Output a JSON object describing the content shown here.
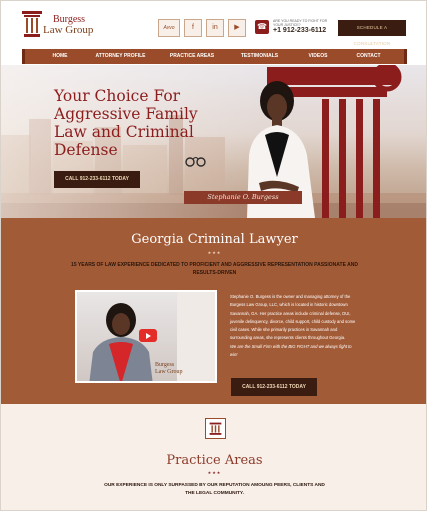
{
  "header": {
    "logo_line1": "Burgess",
    "logo_line2": "Law Group",
    "social": {
      "avvo": "Avvo",
      "facebook": "f",
      "linkedin": "in",
      "youtube": "▶"
    },
    "phone_caption": "ARE YOU READY TO FIGHT FOR YOUR JUSTICE?",
    "phone_number": "+1 912-233-6112",
    "consult_button": "SCHEDULE A CONSULTATION"
  },
  "nav": {
    "items": [
      "HOME",
      "ATTORNEY PROFILE",
      "PRACTICE AREAS",
      "TESTIMONIALS",
      "VIDEOS",
      "CONTACT"
    ]
  },
  "hero": {
    "headline": "Your Choice For Aggressive Family Law and Criminal Defense",
    "cta": "CALL 912-233-6112 TODAY",
    "signature": "Stephanie O. Burgess"
  },
  "georgia": {
    "title": "Georgia Criminal Lawyer",
    "stars": "★★★",
    "subtitle": "15 YEARS OF LAW EXPERIENCE DEDICATED TO PROFICIENT AND AGGRESSIVE REPRESENTATION PASSIONATE AND RESULTS-DRIVEN",
    "video_logo_line1": "Burgess",
    "video_logo_line2": "Law Group",
    "bio": "Stephanie O. Burgess is the owner and managing attorney of the Burgess Law Group, LLC, which is located in historic downtown Savannah, GA. Her practice areas include criminal defense, DUI, juvenile delinquency, divorce, child support, child custody and some civil cases. While she primarily practices in Savannah and surrounding areas, she represents clients throughout Georgia.",
    "bio_tagline": "We are the Small Firm with the BIG FIGHT and we always fight to win!",
    "cta": "CALL 912-233-6112 TODAY"
  },
  "practice": {
    "title": "Practice Areas",
    "stars": "★★★",
    "subtitle": "OUR EXPERIENCE IS ONLY SURPASSED BY OUR REPUTATION AMOUNG PEERS, CLIENTS AND THE LEGAL COMMUNITY."
  },
  "colors": {
    "brand_red": "#8b1d1d",
    "brown": "#9a4b2a",
    "section_brown": "#a25b37",
    "dark_button": "#3a1c10"
  }
}
